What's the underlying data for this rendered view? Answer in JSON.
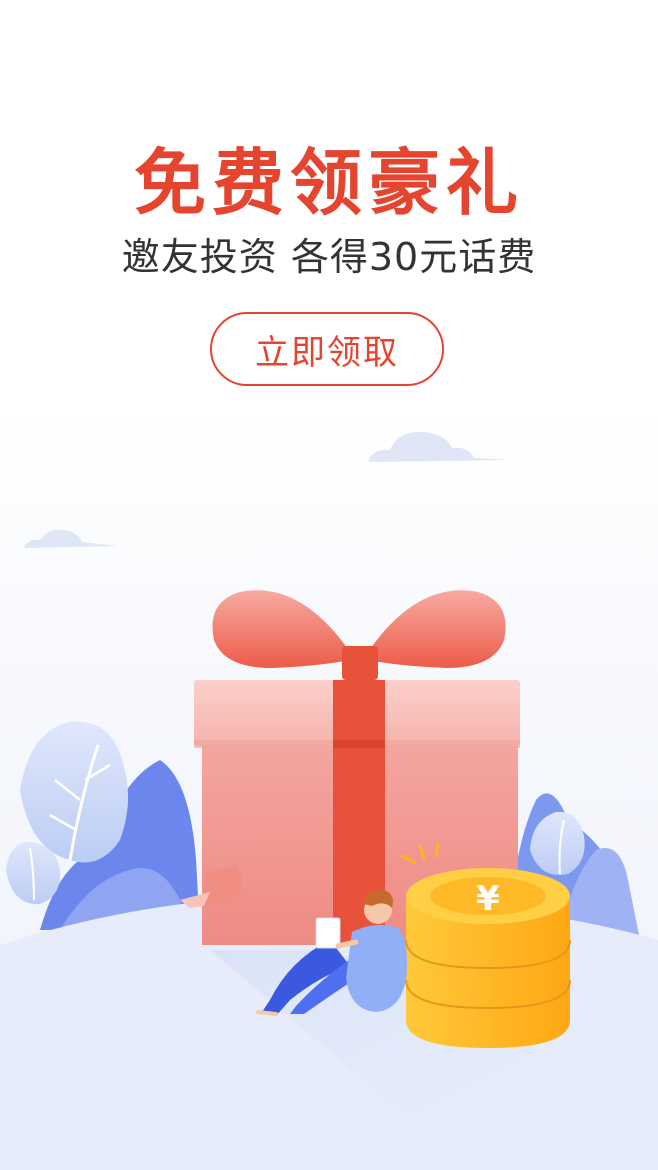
{
  "banner": {
    "title": "免费领豪礼",
    "subtitle": "邀友投资 各得30元话费",
    "button_label": "立即领取"
  },
  "illustration": {
    "currency_symbol": "¥",
    "colors": {
      "accent": "#e5452f",
      "gift_box": "#f3a19a",
      "ribbon": "#e8513a",
      "coin": "#ffb41f",
      "hill": "#e6ecfa",
      "plant_blue": "#6b86ec"
    }
  }
}
